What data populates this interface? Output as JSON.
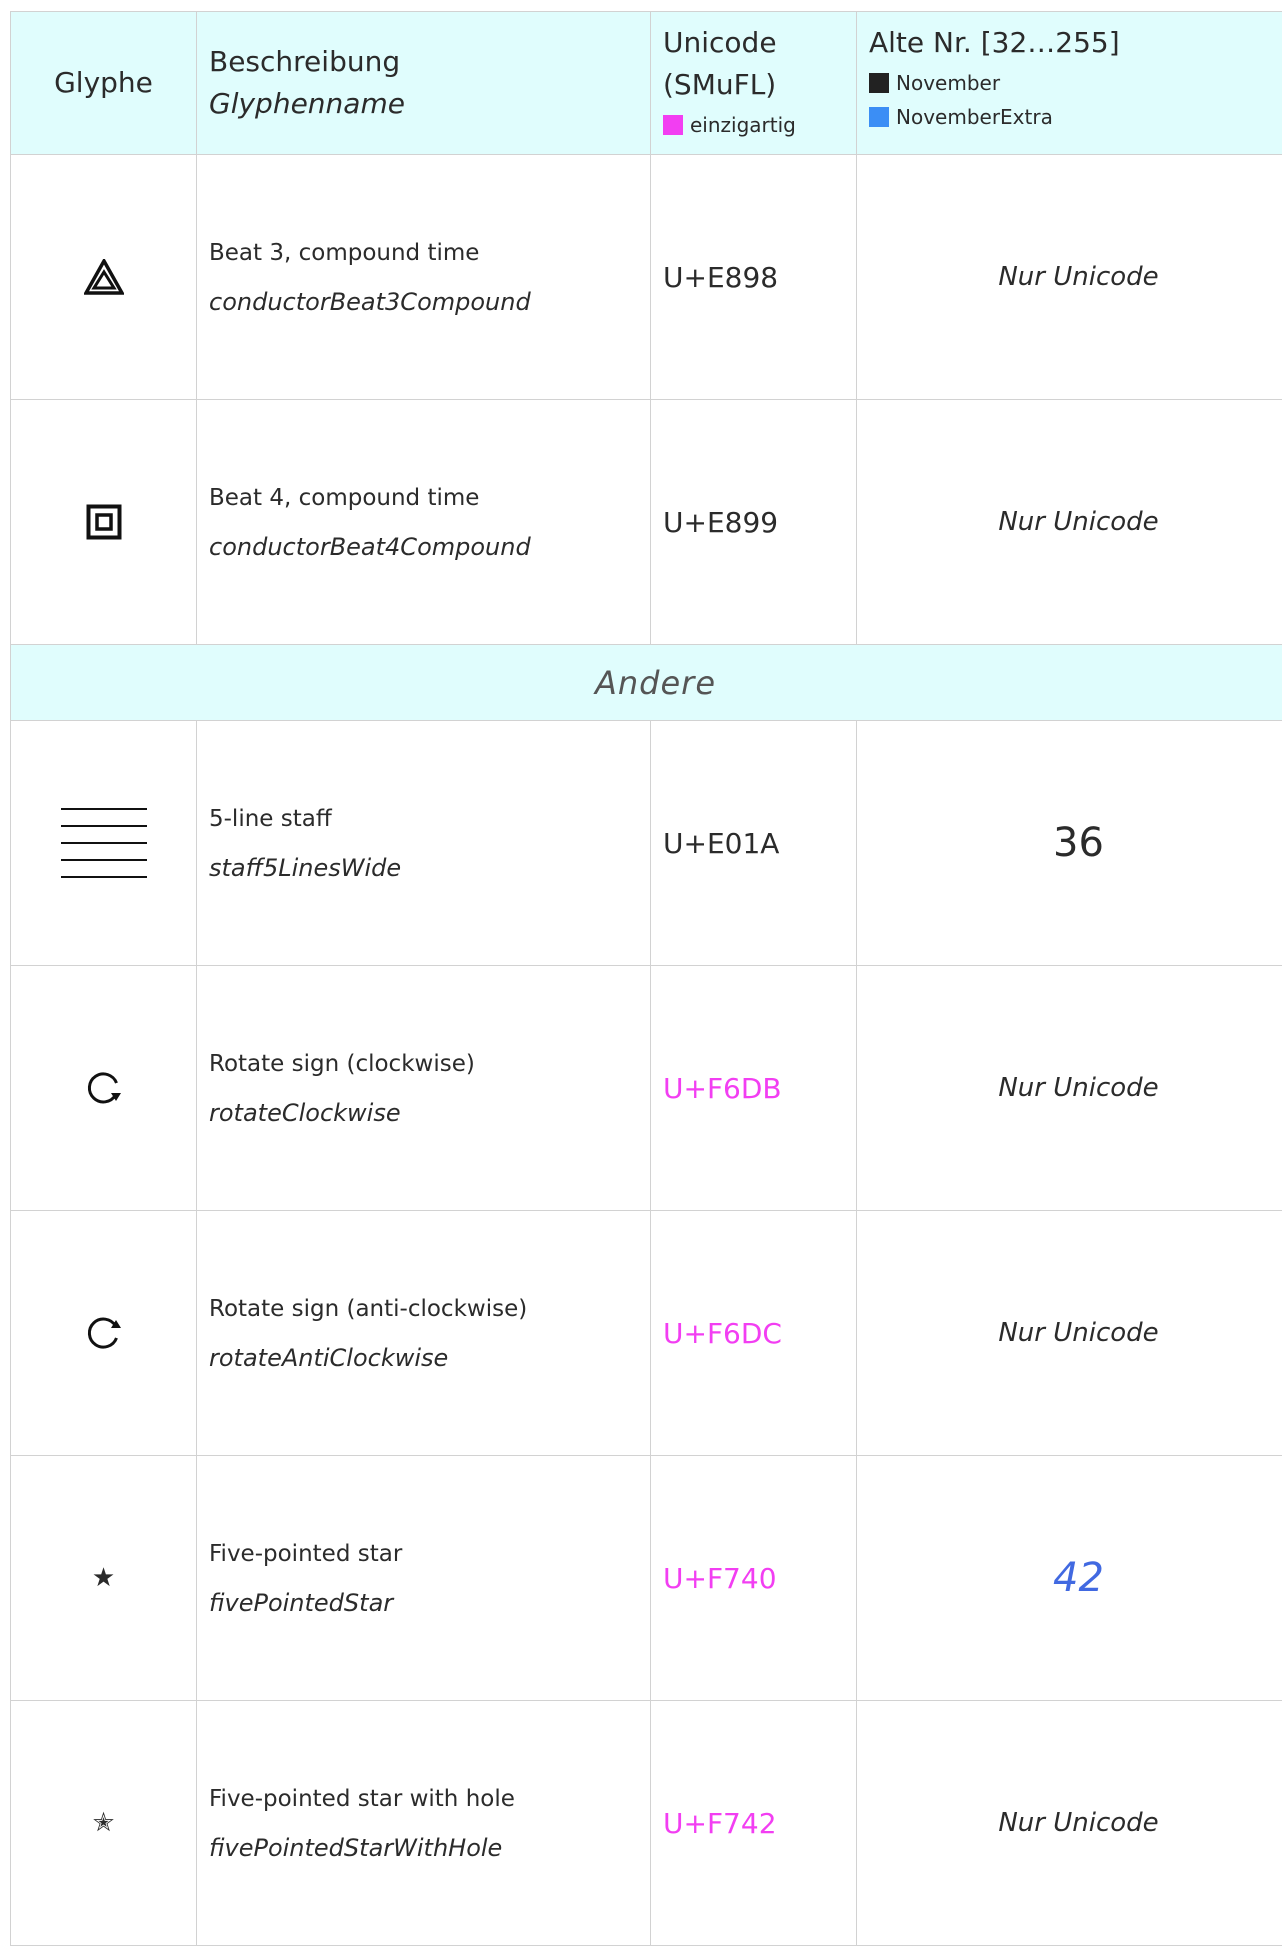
{
  "header": {
    "glyph": "Glyphe",
    "description": "Beschreibung",
    "glyph_name": "Glyphenname",
    "unicode_line1": "Unicode",
    "unicode_line2": "(SMuFL)",
    "unique_legend": "einzigartig",
    "old_number": "Alte Nr. [32…255]",
    "legend_november": "November",
    "legend_november_extra": "NovemberExtra"
  },
  "colors": {
    "header_bg": "#e0fdfd",
    "unique": "#f23ef2",
    "november": "#222222",
    "november_extra": "#3b8ef5"
  },
  "rows_top": [
    {
      "glyph_icon": "triangle-in-triangle-icon",
      "label": "Beat 3, compound time",
      "name": "conductorBeat3Compound",
      "unicode": "U+E898",
      "old": "Nur Unicode"
    },
    {
      "glyph_icon": "square-in-square-icon",
      "label": "Beat 4, compound time",
      "name": "conductorBeat4Compound",
      "unicode": "U+E899",
      "old": "Nur Unicode"
    }
  ],
  "section": {
    "title": "Andere"
  },
  "rows_bottom": [
    {
      "glyph_icon": "five-line-staff-icon",
      "label": "5-line staff",
      "name": "staff5LinesWide",
      "unicode": "U+E01A",
      "old": "36"
    },
    {
      "glyph_icon": "rotate-clockwise-icon",
      "label": "Rotate sign (clockwise)",
      "name": "rotateClockwise",
      "unicode": "U+F6DB",
      "old": "Nur Unicode"
    },
    {
      "glyph_icon": "rotate-anticlockwise-icon",
      "label": "Rotate sign (anti-clockwise)",
      "name": "rotateAntiClockwise",
      "unicode": "U+F6DC",
      "old": "Nur Unicode"
    },
    {
      "glyph_icon": "five-pointed-star-icon",
      "glyph_char": "★",
      "label": "Five-pointed star",
      "name": "fivePointedStar",
      "unicode": "U+F740",
      "old": "42"
    },
    {
      "glyph_icon": "five-pointed-star-with-hole-icon",
      "glyph_char": "✭",
      "label": "Five-pointed star with hole",
      "name": "fivePointedStarWithHole",
      "unicode": "U+F742",
      "old": "Nur Unicode"
    }
  ]
}
